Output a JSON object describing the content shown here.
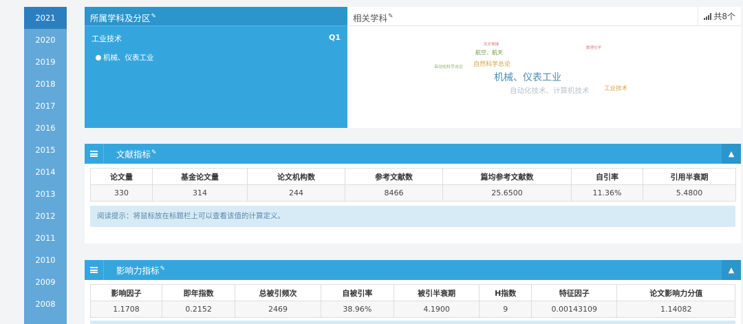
{
  "years": [
    "2021",
    "2020",
    "2019",
    "2018",
    "2017",
    "2016",
    "2015",
    "2014",
    "2013",
    "2012",
    "2011",
    "2010",
    "2009",
    "2008"
  ],
  "active_year": "2021",
  "subject_panel": {
    "title": "所属学科及分区",
    "category": "工业技术",
    "zone": "Q1",
    "sub_item": "机械、仪表工业"
  },
  "related_panel": {
    "title": "相关学科",
    "count": "共8个",
    "cloud_words": [
      {
        "text": "机械、仪表工业",
        "color": "#4a8bb5"
      },
      {
        "text": "自动化技术、计算机技术",
        "color": "#b9c3cc"
      },
      {
        "text": "自然科学总论",
        "color": "#d6a03c"
      },
      {
        "text": "航空、航天",
        "color": "#6d9a3a"
      },
      {
        "text": "工业技术",
        "color": "#d9a541"
      },
      {
        "text": "天文地球",
        "color": "#d46a6a"
      },
      {
        "text": "自动化科学总论",
        "color": "#8db36b"
      },
      {
        "text": "数理化学",
        "color": "#d98080"
      }
    ]
  },
  "literature_section": {
    "title": "文献指标",
    "headers": [
      "论文量",
      "基金论文量",
      "论文机构数",
      "参考文献数",
      "篇均参考文献数",
      "自引率",
      "引用半衰期"
    ],
    "values": [
      "330",
      "314",
      "244",
      "8466",
      "25.6500",
      "11.36%",
      "5.4800"
    ],
    "tip": "阅读提示：将鼠标放在标题栏上可以查看该值的计算定义。"
  },
  "impact_section": {
    "title": "影响力指标",
    "headers": [
      "影响因子",
      "即年指数",
      "总被引频次",
      "自被引率",
      "被引半衰期",
      "H指数",
      "特征因子",
      "论文影响力分值"
    ],
    "values": [
      "1.1708",
      "0.2152",
      "2469",
      "38.96%",
      "4.1900",
      "9",
      "0.00143109",
      "1.14082"
    ]
  },
  "colors": {
    "primary": "#35a6dd",
    "sidebar": "#62a8d8",
    "sidebar_active": "#2c7fbf",
    "tip_bg": "#d7ebf7"
  },
  "icons": [
    "pencil-icon",
    "signal-bars-icon",
    "menu-icon",
    "chevron-up-icon"
  ]
}
